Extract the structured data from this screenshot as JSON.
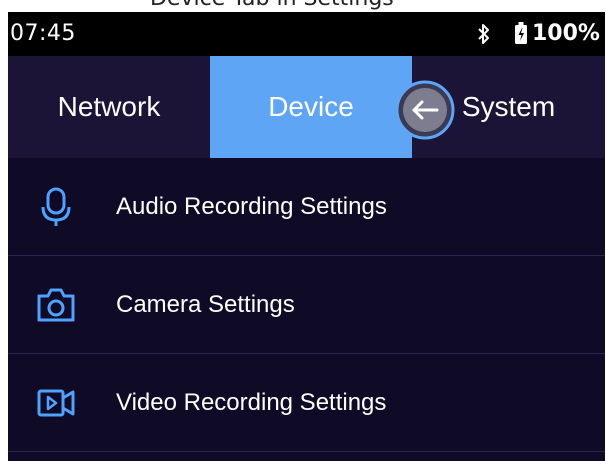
{
  "top_caption": "Device Tab in Settings",
  "statusbar": {
    "time": "07:45",
    "battery": "100%",
    "icons": [
      "bluetooth-icon",
      "battery-icon"
    ]
  },
  "tabs": [
    {
      "label": "Network",
      "selected": false
    },
    {
      "label": "Device",
      "selected": true
    },
    {
      "label": "System",
      "selected": false
    }
  ],
  "overlay": {
    "icon": "back-arrow-icon"
  },
  "settings": [
    {
      "label": "Audio Recording Settings",
      "icon": "microphone-icon"
    },
    {
      "label": "Camera Settings",
      "icon": "camera-icon"
    },
    {
      "label": "Video Recording Settings",
      "icon": "video-camera-icon"
    }
  ],
  "colors": {
    "background": "#0f0a26",
    "tab_bar": "#1b1437",
    "accent": "#5ea6f5",
    "icon": "#4da3ff"
  }
}
